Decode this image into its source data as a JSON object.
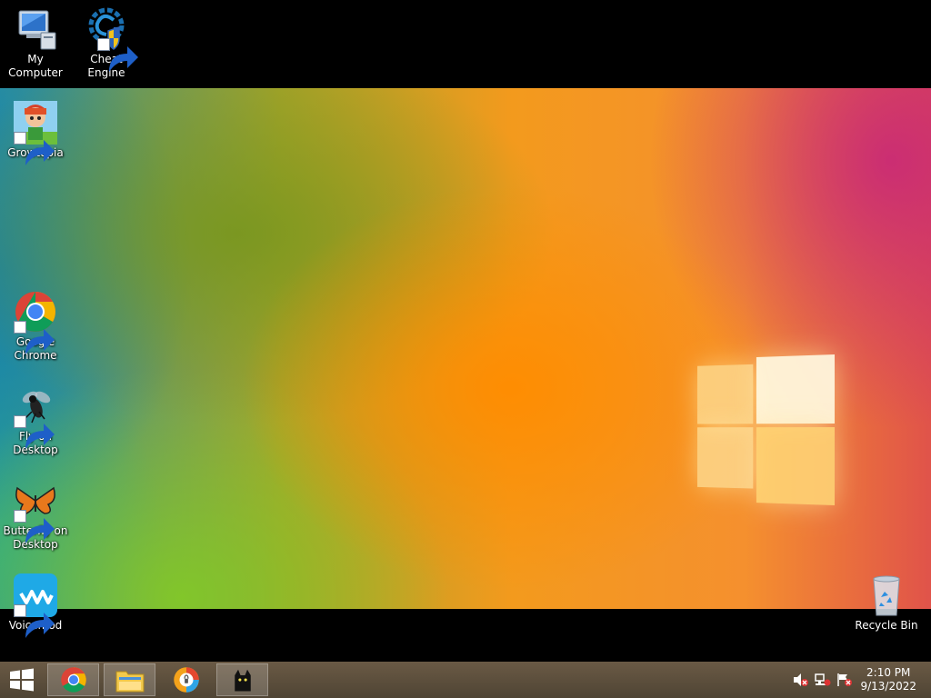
{
  "desktop": {
    "icons": [
      {
        "label": "My Computer",
        "icon": "computer-icon"
      },
      {
        "label": "Cheat Engine",
        "icon": "cheat-engine-icon"
      },
      {
        "label": "Growtopia",
        "icon": "growtopia-icon"
      },
      {
        "label": "Google Chrome",
        "icon": "chrome-icon"
      },
      {
        "label": "Fly on Desktop",
        "icon": "fly-icon"
      },
      {
        "label": "Butterfly on Desktop",
        "icon": "butterfly-icon"
      },
      {
        "label": "Voicemod",
        "icon": "voicemod-icon"
      },
      {
        "label": "Recycle Bin",
        "icon": "recycle-bin-icon"
      }
    ]
  },
  "taskbar": {
    "apps": [
      {
        "name": "Google Chrome",
        "icon": "chrome-icon"
      },
      {
        "name": "File Explorer",
        "icon": "folder-icon"
      },
      {
        "name": "Avast Secure Browser",
        "icon": "secure-browser-icon"
      },
      {
        "name": "Cat",
        "icon": "cat-icon"
      }
    ],
    "tray": {
      "icons": [
        "speaker-muted-icon",
        "network-icon",
        "action-center-flag-icon"
      ]
    },
    "clock": {
      "time": "2:10 PM",
      "date": "9/13/2022"
    }
  },
  "colors": {
    "taskbar": "#5a4c3a",
    "desktop_bar": "#000000"
  }
}
